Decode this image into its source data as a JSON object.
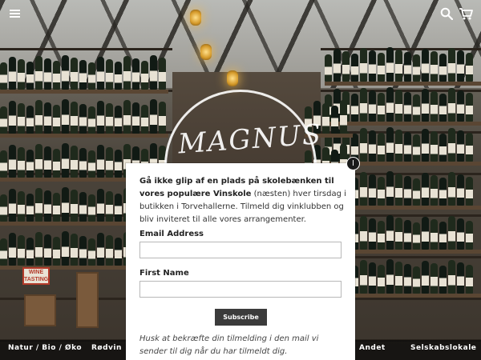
{
  "header": {
    "menu_icon": "hamburger-menu-icon",
    "search_icon": "search-icon",
    "cart_icon": "cart-icon"
  },
  "background": {
    "logo_text": "MAGNUS",
    "sign_text": "WINE TASTING"
  },
  "nav": {
    "items": [
      {
        "label": "Natur / Bio / Øko"
      },
      {
        "label": "Rødvin"
      },
      {
        "label": "Andet"
      },
      {
        "label": "Selskabslokale"
      }
    ]
  },
  "popup": {
    "close_label": "I",
    "intro_bold": "Gå ikke glip af en plads på skolebænken til vores populære Vinskole",
    "intro_rest": " (næsten) hver tirsdag i butikken i Torvehallerne. Tilmeld dig vinklubben og bliv inviteret til alle vores arrangementer.",
    "email_label": "Email Address",
    "email_value": "",
    "firstname_label": "First Name",
    "firstname_value": "",
    "subscribe_label": "Subscribe",
    "note": "Husk at bekræfte din tilmelding i den mail vi sender til dig når du har tilmeldt dig."
  },
  "colors": {
    "popup_bg": "#ffffff",
    "button_bg": "#3b3b3b",
    "nav_bg": "#0a0a0a"
  }
}
